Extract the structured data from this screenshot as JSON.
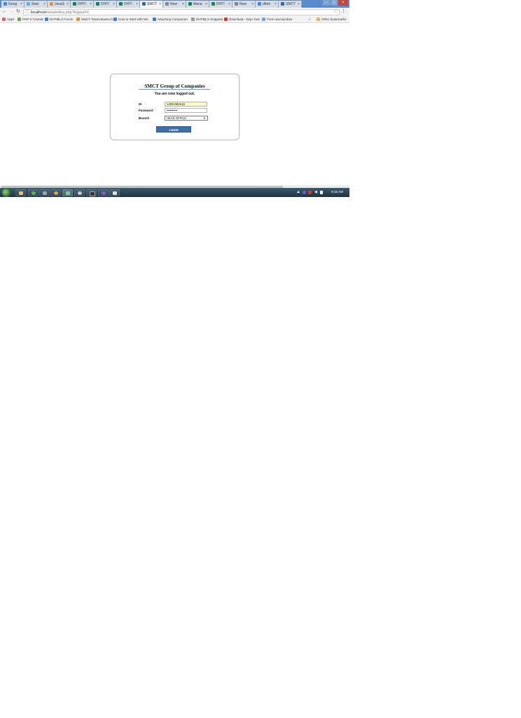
{
  "browser": {
    "tabs": [
      {
        "label": "Goog",
        "fav": "#4285f4",
        "active": false
      },
      {
        "label": "Start",
        "fav": "#6fa8dc",
        "active": false
      },
      {
        "label": "JavaS",
        "fav": "#e69138",
        "active": false
      },
      {
        "label": "DHTI",
        "fav": "#0b8a4d",
        "active": false
      },
      {
        "label": "DHTI",
        "fav": "#0b8a4d",
        "active": false
      },
      {
        "label": "DHTI",
        "fav": "#0b8a4d",
        "active": false
      },
      {
        "label": "SMCT",
        "fav": "#2e6da4",
        "active": true
      },
      {
        "label": "New",
        "fav": "#888888",
        "active": false
      },
      {
        "label": "Mana",
        "fav": "#0b8a4d",
        "active": false
      },
      {
        "label": "DHTI",
        "fav": "#0b8a4d",
        "active": false
      },
      {
        "label": "New",
        "fav": "#888888",
        "active": false
      },
      {
        "label": "dhtm",
        "fav": "#4285f4",
        "active": false
      },
      {
        "label": "SMCT",
        "fav": "#2e6da4",
        "active": false
      }
    ],
    "close_glyph": "×",
    "window_buttons": {
      "minimize": "–",
      "maximize": "□",
      "close": "×"
    },
    "nav": {
      "back": "←",
      "forward": "→",
      "reload": "↻"
    },
    "url": {
      "host": "localhost",
      "path": "/new/index.php?logout=1"
    },
    "star": "☆",
    "menu": "⋮",
    "bookmarks": [
      {
        "label": "Apps",
        "color": "#e06666"
      },
      {
        "label": "PHP 5 Tutorial",
        "color": "#6aa84f"
      },
      {
        "label": "DHTMLX Forum",
        "color": "#3d85c6"
      },
      {
        "label": "SMCT Teamviewers D",
        "color": "#e69138"
      },
      {
        "label": "How to Start with Mo",
        "color": "#3d85c6"
      },
      {
        "label": "Attaching Componen",
        "color": "#3d85c6"
      },
      {
        "label": "DHTMLX Snippets",
        "color": "#999999"
      },
      {
        "label": "Download - Dojo Tool",
        "color": "#cc4125"
      },
      {
        "label": "Form and window",
        "color": "#6fa8dc"
      }
    ],
    "more_bookmarks": "»",
    "other_bookmarks": "Other bookmarks"
  },
  "login": {
    "title": "SMCT Group of Companies",
    "message": "You are now logged out.",
    "id_label": "ID",
    "id_value": "1409-081516",
    "password_label": "Password",
    "password_value": "••••••••••",
    "branch_label": "Branch",
    "branch_value": "HEAD OFFICE",
    "submit_label": "LOGIN"
  },
  "taskbar": {
    "clock": "9:16 AM"
  }
}
